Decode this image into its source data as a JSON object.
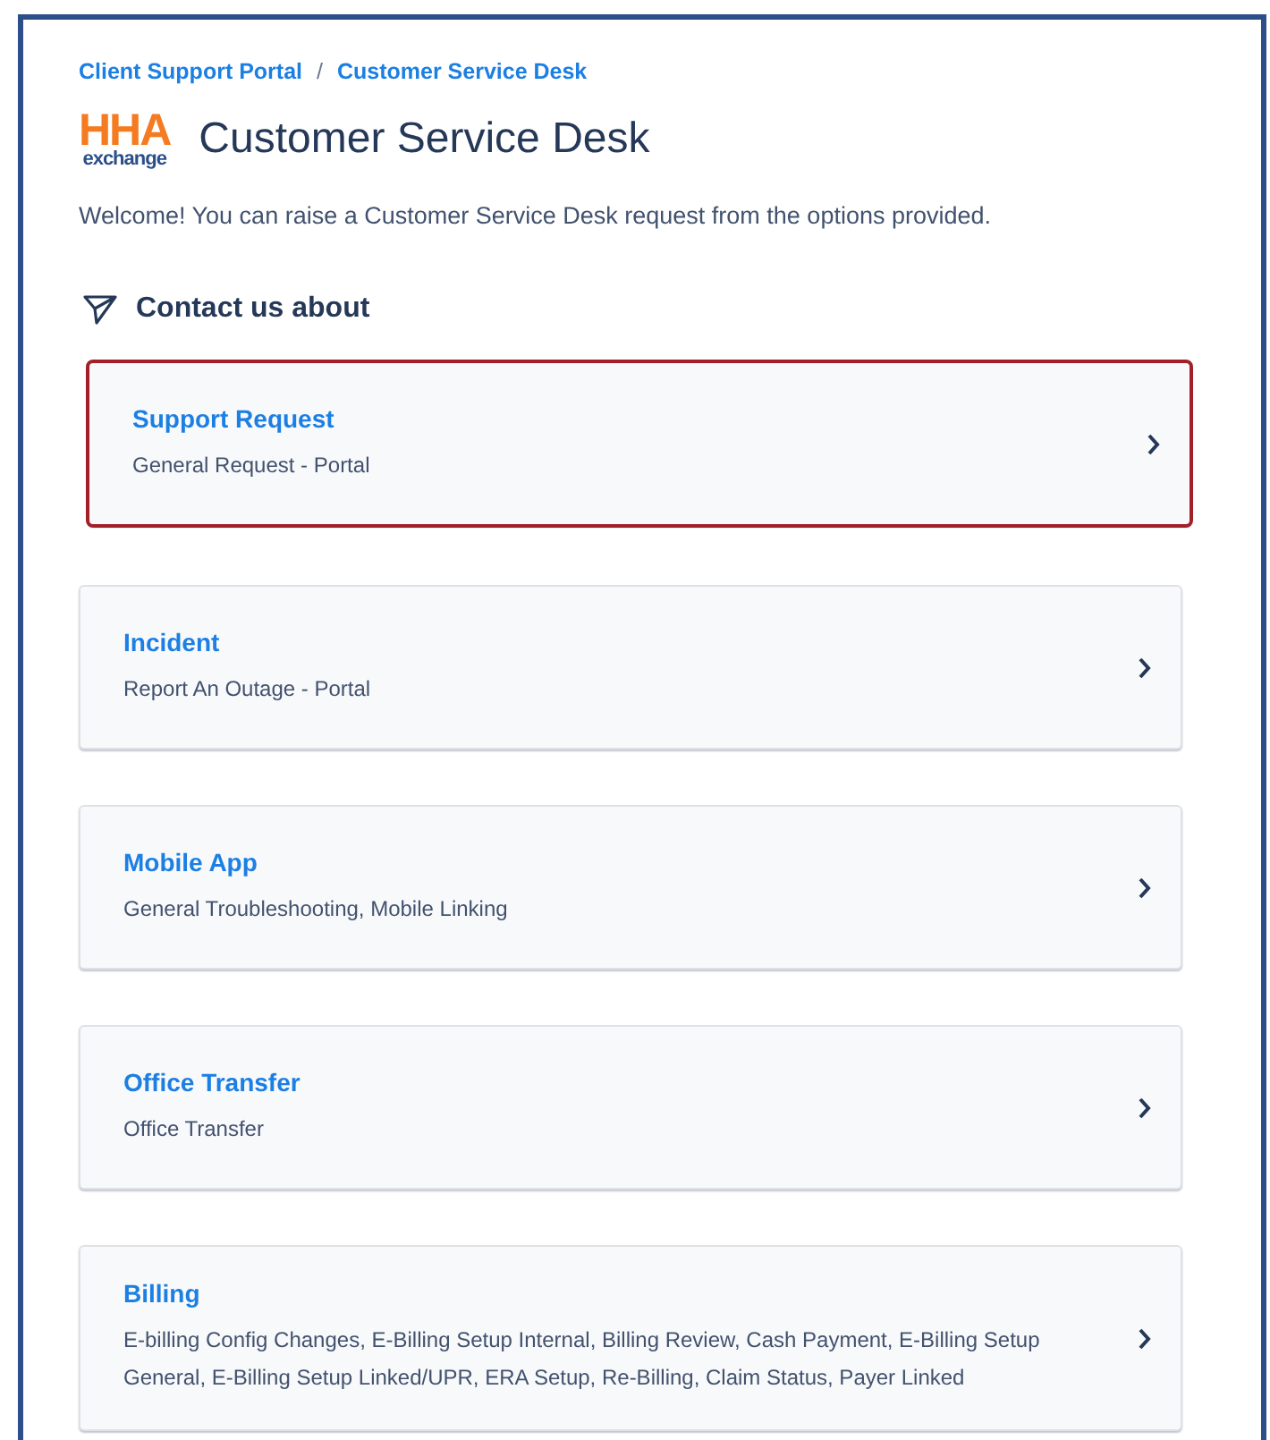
{
  "breadcrumbs": [
    "Client Support Portal",
    "Customer Service Desk"
  ],
  "breadcrumb_separator": "/",
  "logo": {
    "top": "HHA",
    "bottom": "exchange"
  },
  "title": "Customer Service Desk",
  "welcome": "Welcome! You can raise a Customer Service Desk request from the options provided.",
  "section_title": "Contact us about",
  "request_types": [
    {
      "title": "Support Request",
      "description": "General Request - Portal",
      "highlighted": true
    },
    {
      "title": "Incident",
      "description": "Report An Outage - Portal",
      "highlighted": false
    },
    {
      "title": "Mobile App",
      "description": "General Troubleshooting, Mobile Linking",
      "highlighted": false
    },
    {
      "title": "Office Transfer",
      "description": "Office Transfer",
      "highlighted": false
    },
    {
      "title": "Billing",
      "description": "E-billing Config Changes, E-Billing Setup Internal, Billing Review, Cash Payment, E-Billing Setup General, E-Billing Setup Linked/UPR, ERA Setup, Re-Billing, Claim Status, Payer Linked",
      "highlighted": false
    }
  ]
}
